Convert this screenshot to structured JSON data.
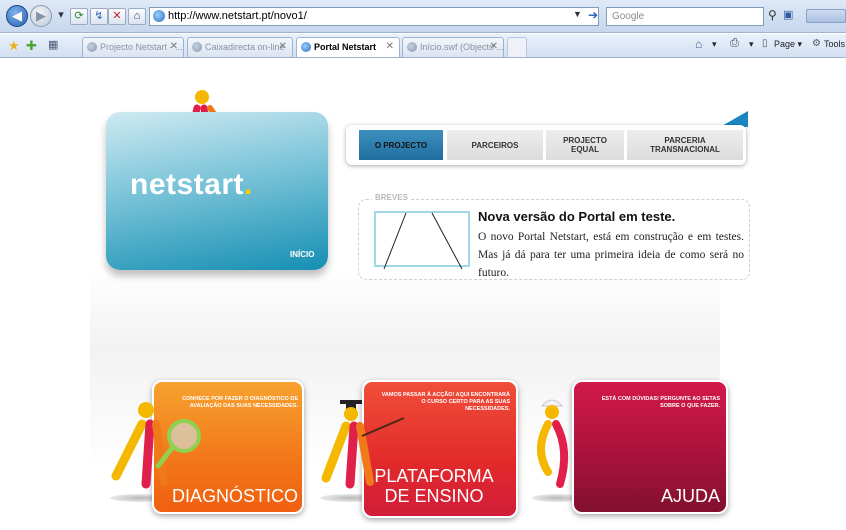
{
  "browser": {
    "url": "http://www.netstart.pt/novo1/",
    "search_placeholder": "Google",
    "tabs": [
      {
        "label": "Projecto Netstart - ...",
        "active": false
      },
      {
        "label": "Caixadirecta on-line",
        "active": false
      },
      {
        "label": "Portal Netstart",
        "active": true
      },
      {
        "label": "Início.swf (Objecto ...",
        "active": false
      }
    ],
    "page_menu": "Page",
    "tools_menu": "Tools"
  },
  "logo": {
    "text": "netstart",
    "dot": ".",
    "home_link": "INÍCIO"
  },
  "menu": {
    "items": [
      {
        "label": "O PROJECTO",
        "active": true
      },
      {
        "label": "PARCEIROS",
        "active": false
      },
      {
        "label": "PROJECTO EQUAL",
        "active": false
      },
      {
        "label": "PARCERIA TRANSNACIONAL",
        "active": false
      }
    ]
  },
  "news": {
    "section_label": "BREVES",
    "title": "Nova versão do Portal em teste.",
    "body": "O novo Portal Netstart, está em construção e em testes. Mas já dá para ter uma primeira ideia de como será no futuro."
  },
  "cards": [
    {
      "small": "CONHECE POR FAZER O DIAGNÓSTICO DE AVALIAÇÃO DAS SUAS NECESSIDADES.",
      "title_line1": "",
      "title_line2": "DIAGNÓSTICO"
    },
    {
      "small": "VAMOS PASSAR À ACÇÃO! AQUI ENCONTRARÁ O CURSO CERTO PARA AS SUAS NECESSIDADES.",
      "title_line1": "PLATAFORMA",
      "title_line2": "DE ENSINO"
    },
    {
      "small": "ESTÁ COM DÚVIDAS! PERGUNTE AO SETAS SOBRE O QUE FAZER.",
      "title_line1": "",
      "title_line2": "AJUDA"
    }
  ],
  "colors": {
    "brand_blue": "#1b86c2",
    "diag_orange": "#f37a1a",
    "plat_red": "#e22a2a",
    "ajuda_crimson": "#a6123c"
  }
}
